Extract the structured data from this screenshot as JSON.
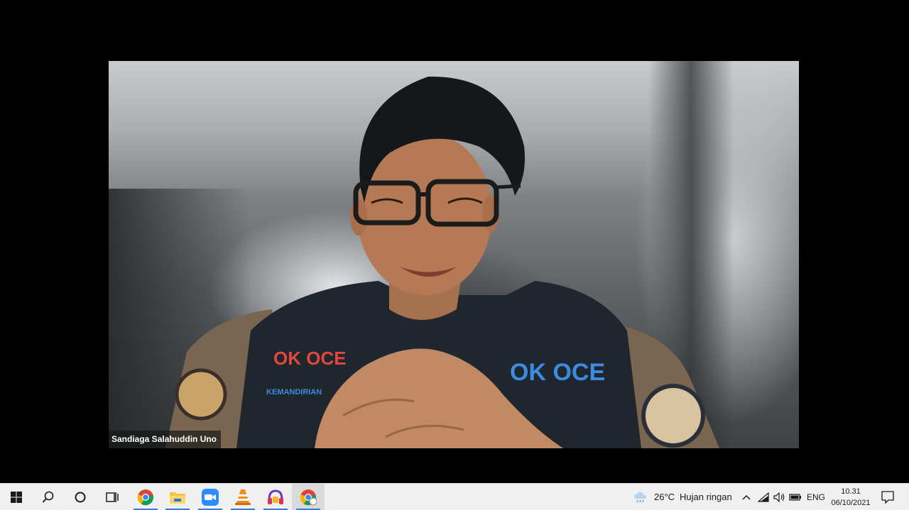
{
  "meeting": {
    "participant_name": "Sandiaga Salahuddin Uno",
    "vest_text_left": "OK OCE",
    "vest_text_left_sub": "KEMANDIRIAN",
    "vest_text_right": "OK OCE"
  },
  "taskbar": {
    "apps": [
      {
        "name": "windows-start",
        "icon": "windows-icon"
      },
      {
        "name": "search",
        "icon": "search-icon"
      },
      {
        "name": "cortana",
        "icon": "circle-icon"
      },
      {
        "name": "task-view",
        "icon": "task-view-icon"
      },
      {
        "name": "chrome",
        "icon": "chrome-icon"
      },
      {
        "name": "file-explorer",
        "icon": "folder-icon"
      },
      {
        "name": "zoom",
        "icon": "zoom-icon"
      },
      {
        "name": "vlc",
        "icon": "vlc-cone-icon"
      },
      {
        "name": "audio-app",
        "icon": "headphones-icon"
      },
      {
        "name": "chrome-profile",
        "icon": "chrome-icon"
      }
    ],
    "weather": {
      "temperature": "26°C",
      "condition": "Hujan ringan"
    },
    "language": "ENG",
    "time": "10.31",
    "date": "06/10/2021",
    "colors": {
      "taskbar_bg": "#f0f0f0",
      "active_indicator": "#3a7bd5"
    }
  }
}
